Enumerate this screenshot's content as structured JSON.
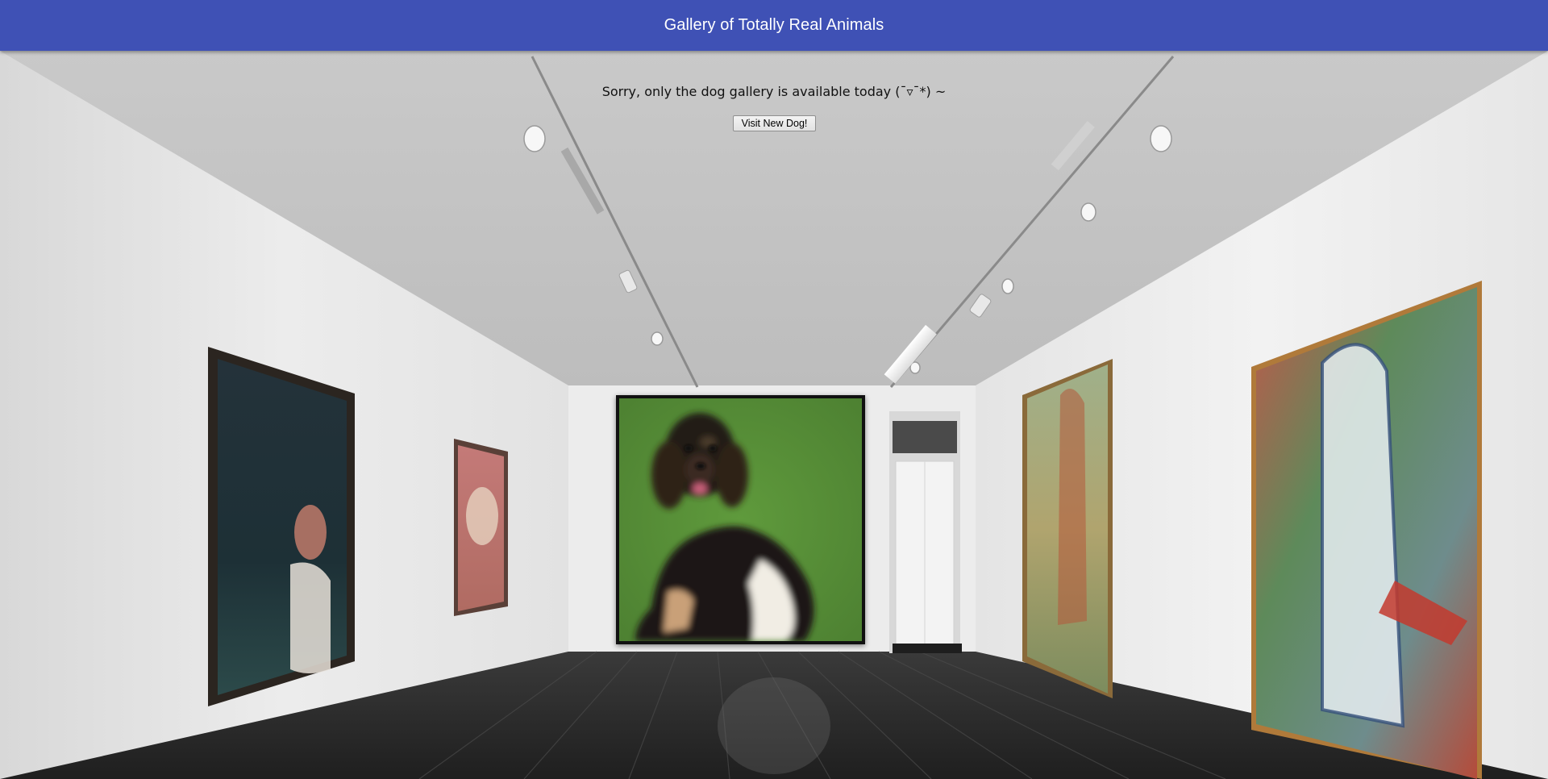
{
  "app_bar": {
    "title": "Gallery of Totally Real Animals",
    "color": "#3f51b5"
  },
  "notice": {
    "message": "Sorry, only the dog gallery is available today (¯▿¯*) ~"
  },
  "actions": {
    "visit_new_dog_label": "Visit New Dog!"
  },
  "featured_artwork": {
    "subject": "dog",
    "icon": "dog-image"
  }
}
